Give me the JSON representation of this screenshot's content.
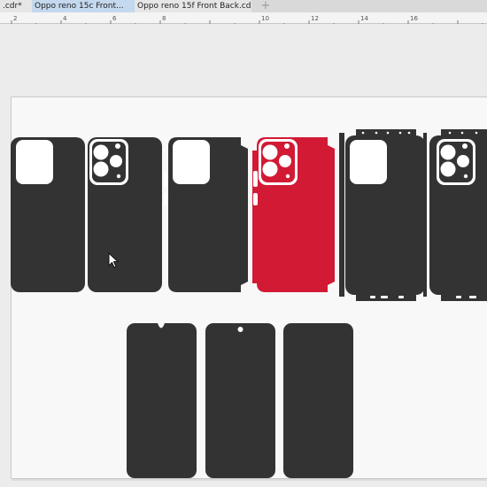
{
  "tabs": [
    {
      "label": ".cdr*"
    },
    {
      "label": "Oppo reno 15c Front..."
    },
    {
      "label": "Oppo reno 15f Front Back.cdr"
    }
  ],
  "add_tab_symbol": "+",
  "ruler_labels": [
    "2",
    "4",
    "6",
    "8",
    "10",
    "12",
    "14",
    "16"
  ],
  "colors": {
    "skin_dark": "#333333",
    "skin_red": "#d21a35",
    "page_bg": "#f8f8f8",
    "tab_active": "#c4d8ee"
  }
}
